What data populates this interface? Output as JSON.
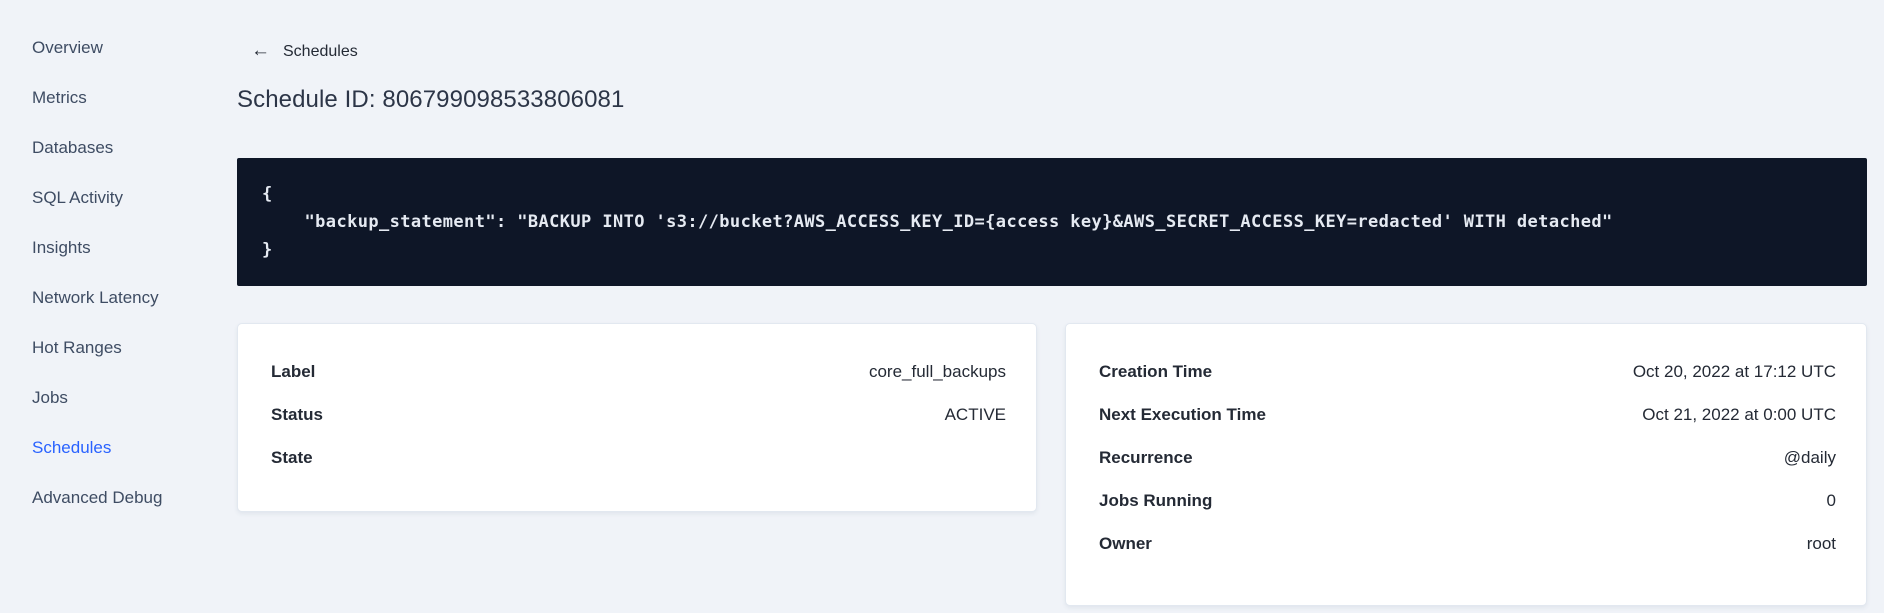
{
  "colors": {
    "page_bg": "#f0f3f8",
    "card_bg": "#ffffff",
    "accent_blue": "#2962ff",
    "code_block_bg": "#0e1627",
    "code_text": "#e5eaf2"
  },
  "sidebar": {
    "items": [
      {
        "label": "Overview",
        "active": false
      },
      {
        "label": "Metrics",
        "active": false
      },
      {
        "label": "Databases",
        "active": false
      },
      {
        "label": "SQL Activity",
        "active": false
      },
      {
        "label": "Insights",
        "active": false
      },
      {
        "label": "Network Latency",
        "active": false
      },
      {
        "label": "Hot Ranges",
        "active": false
      },
      {
        "label": "Jobs",
        "active": false
      },
      {
        "label": "Schedules",
        "active": true
      },
      {
        "label": "Advanced Debug",
        "active": false
      }
    ]
  },
  "header": {
    "back_icon": "←",
    "back_label": "Schedules",
    "title": "Schedule ID: 806799098533806081"
  },
  "code_block": {
    "lines": [
      {
        "text": "{"
      },
      {
        "text": "    \"backup_statement\": \"BACKUP INTO 's3://bucket?AWS_ACCESS_KEY_ID={access key}&AWS_SECRET_ACCESS_KEY=redacted' WITH detached\""
      },
      {
        "text": "}"
      }
    ]
  },
  "details_card": {
    "rows": [
      {
        "label": "Label",
        "value": "core_full_backups"
      },
      {
        "label": "Status",
        "value": "ACTIVE"
      },
      {
        "label": "State",
        "value": ""
      }
    ]
  },
  "schedule_card": {
    "rows": [
      {
        "label": "Creation Time",
        "value": "Oct 20, 2022 at 17:12 UTC"
      },
      {
        "label": "Next Execution Time",
        "value": "Oct 21, 2022 at 0:00 UTC"
      },
      {
        "label": "Recurrence",
        "value": "@daily"
      },
      {
        "label": "Jobs Running",
        "value": "0"
      },
      {
        "label": "Owner",
        "value": "root"
      }
    ]
  }
}
